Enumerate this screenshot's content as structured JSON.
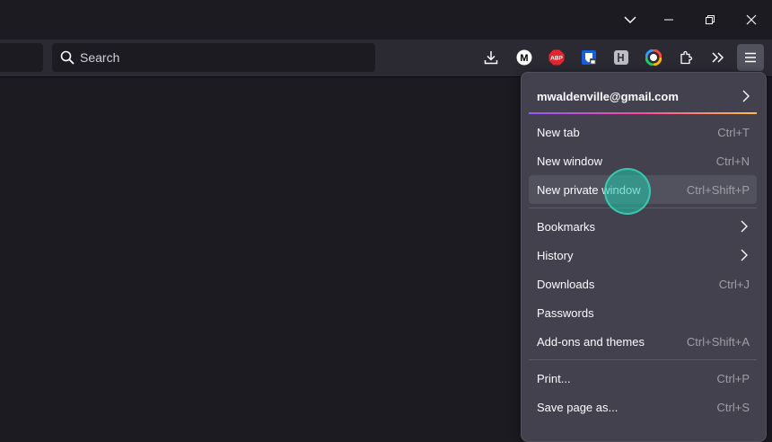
{
  "search": {
    "placeholder": "Search"
  },
  "toolbar": {
    "icons": [
      "downloads-icon",
      "medium-icon",
      "adblock-plus-icon",
      "bitwarden-icon",
      "hk-extension-icon",
      "color-picker-icon",
      "extensions-icon",
      "overflow-icon",
      "app-menu-icon"
    ],
    "abp_label": "ABP",
    "m_label": "M"
  },
  "colors": {
    "accent_cursor": "#20c8aa",
    "menu_bg": "#42414d",
    "toolbar_bg": "#2b2a33",
    "page_bg": "#1c1b22"
  },
  "menu": {
    "account": "mwaldenville@gmail.com",
    "group1": [
      {
        "label": "New tab",
        "shortcut": "Ctrl+T"
      },
      {
        "label": "New window",
        "shortcut": "Ctrl+N"
      },
      {
        "label": "New private window",
        "shortcut": "Ctrl+Shift+P"
      }
    ],
    "group2": [
      {
        "label": "Bookmarks",
        "shortcut": ""
      },
      {
        "label": "History",
        "shortcut": ""
      },
      {
        "label": "Downloads",
        "shortcut": "Ctrl+J"
      },
      {
        "label": "Passwords",
        "shortcut": ""
      },
      {
        "label": "Add-ons and themes",
        "shortcut": "Ctrl+Shift+A"
      }
    ],
    "group3": [
      {
        "label": "Print...",
        "shortcut": "Ctrl+P"
      },
      {
        "label": "Save page as...",
        "shortcut": "Ctrl+S"
      }
    ]
  }
}
